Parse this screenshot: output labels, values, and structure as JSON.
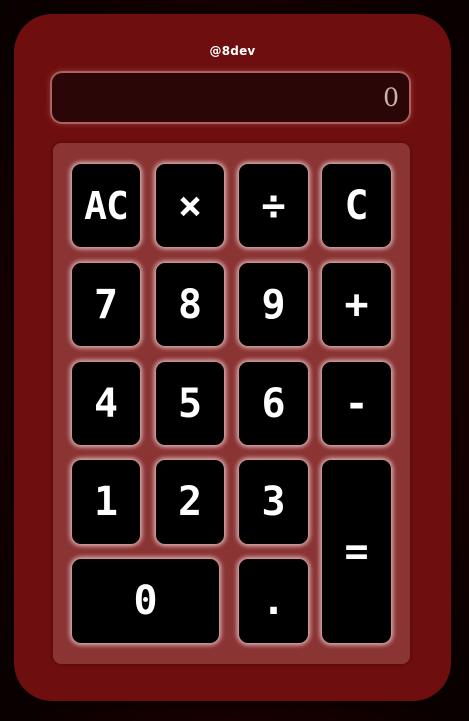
{
  "calculator": {
    "brand": "@8dev",
    "display_value": "0",
    "keys": {
      "all_clear": "AC",
      "multiply": "×",
      "divide": "÷",
      "clear": "C",
      "seven": "7",
      "eight": "8",
      "nine": "9",
      "plus": "+",
      "four": "4",
      "five": "5",
      "six": "6",
      "minus": "-",
      "one": "1",
      "two": "2",
      "three": "3",
      "equals": "=",
      "zero": "0",
      "decimal": "."
    },
    "colors": {
      "body": "#6e0e0e",
      "keypad": "#8a3434",
      "display_bg": "#2a0606",
      "key_bg": "#000000",
      "key_text": "#ffffff",
      "background": "#1f0101"
    }
  }
}
